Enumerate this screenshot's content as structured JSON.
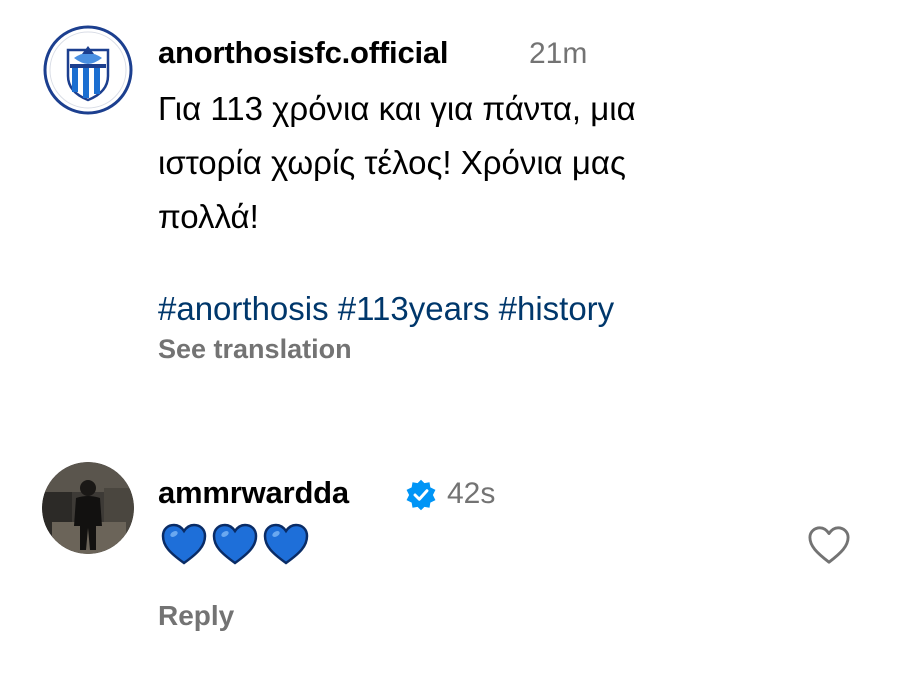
{
  "post": {
    "username": "anorthosisfc.official",
    "time": "21m",
    "caption_lines": [
      "Για 113 χρόνια και για πάντα, μια",
      "ιστορία χωρίς τέλος! Χρόνια μας",
      "πολλά!"
    ],
    "hashtags": [
      "#anorthosis",
      "#113years",
      "#history"
    ],
    "see_translation": "See translation",
    "avatar_icon": "club-crest-icon"
  },
  "comment": {
    "username": "ammrwardda",
    "verified": true,
    "time": "42s",
    "emoji": [
      "blue-heart-icon",
      "blue-heart-icon",
      "blue-heart-icon"
    ],
    "reply_label": "Reply",
    "like_icon": "heart-outline-icon"
  },
  "colors": {
    "text": "#000000",
    "secondary": "#737373",
    "hashtag": "#00376b",
    "verified_badge": "#0095f6",
    "heart_emoji": "#1e6fd9"
  }
}
